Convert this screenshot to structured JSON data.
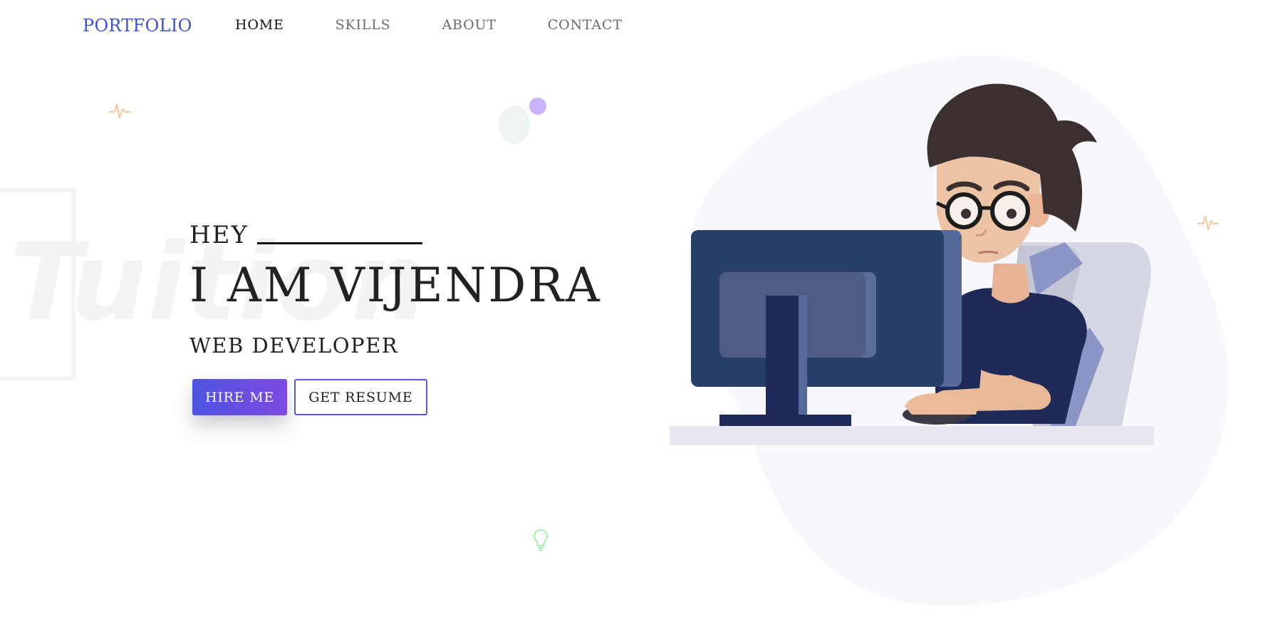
{
  "nav": {
    "logo": "PORTFOLIO",
    "links": [
      {
        "label": "HOME",
        "active": true
      },
      {
        "label": "SKILLS",
        "active": false
      },
      {
        "label": "ABOUT",
        "active": false
      },
      {
        "label": "CONTACT",
        "active": false
      }
    ]
  },
  "hero": {
    "greeting": "HEY",
    "name": "I AM VIJENDRA",
    "role": "WEB DEVELOPER",
    "hire_label": "HIRE ME",
    "resume_label": "GET RESUME"
  },
  "watermark": "Tuition",
  "colors": {
    "accent": "#3b4fd8",
    "button_gradient_start": "#4d55e0",
    "button_gradient_end": "#7f49e0",
    "blob": "#f7f7fd"
  },
  "icons": [
    "pulse-icon",
    "lightbulb-icon",
    "developer-illustration"
  ]
}
